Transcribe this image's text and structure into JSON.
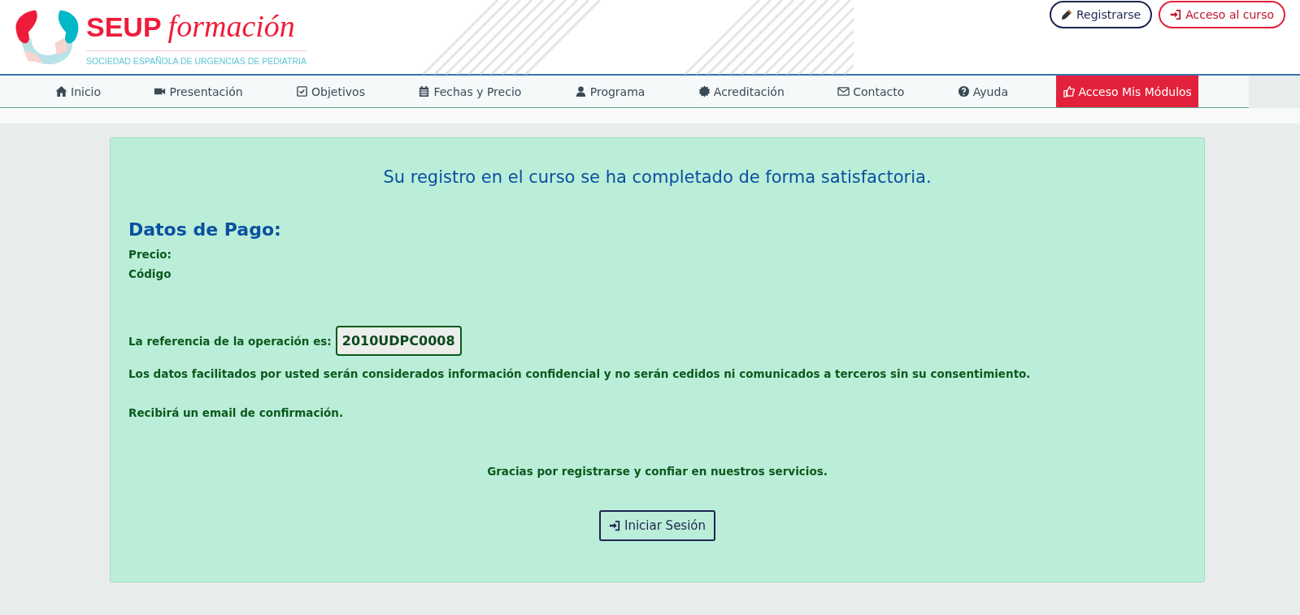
{
  "logo": {
    "brand": "SEUP",
    "word": "formación",
    "subtitle": "SOCIEDAD ESPAÑOLA DE URGENCIAS DE PEDIATRIA"
  },
  "header_buttons": [
    {
      "label": "Registrarse",
      "kind": "outline-dark"
    },
    {
      "label": "Acceso al curso",
      "kind": "outline-red"
    }
  ],
  "nav": [
    {
      "label": "Inicio",
      "selected": false
    },
    {
      "label": "Presentación",
      "selected": false
    },
    {
      "label": "Objetivos",
      "selected": false
    },
    {
      "label": "Fechas y Precio",
      "selected": false
    },
    {
      "label": "Programa",
      "selected": false
    },
    {
      "label": "Acreditación",
      "selected": false
    },
    {
      "label": "Contacto",
      "selected": false
    },
    {
      "label": "Ayuda",
      "selected": false
    },
    {
      "label": "Acceso Mis Módulos",
      "selected": true
    }
  ],
  "panel": {
    "message": "Su registro en el curso se ha completado de forma satisfactoria.",
    "heading": "Datos de Pago:",
    "price_label": "Precio:",
    "code_label": "Código",
    "reference_label": "La referencia de la operación es:",
    "reference": "2010UDPC0008",
    "privacy": "Los datos facilitados por usted serán considerados información confidencial y no serán cedidos ni comunicados a terceros sin su consentimiento.",
    "email_note": "Recibirá un email de confirmación.",
    "thanks": "Gracias por registrarse y confiar en nuestros servicios.",
    "login_button": "Iniciar Sesión"
  }
}
